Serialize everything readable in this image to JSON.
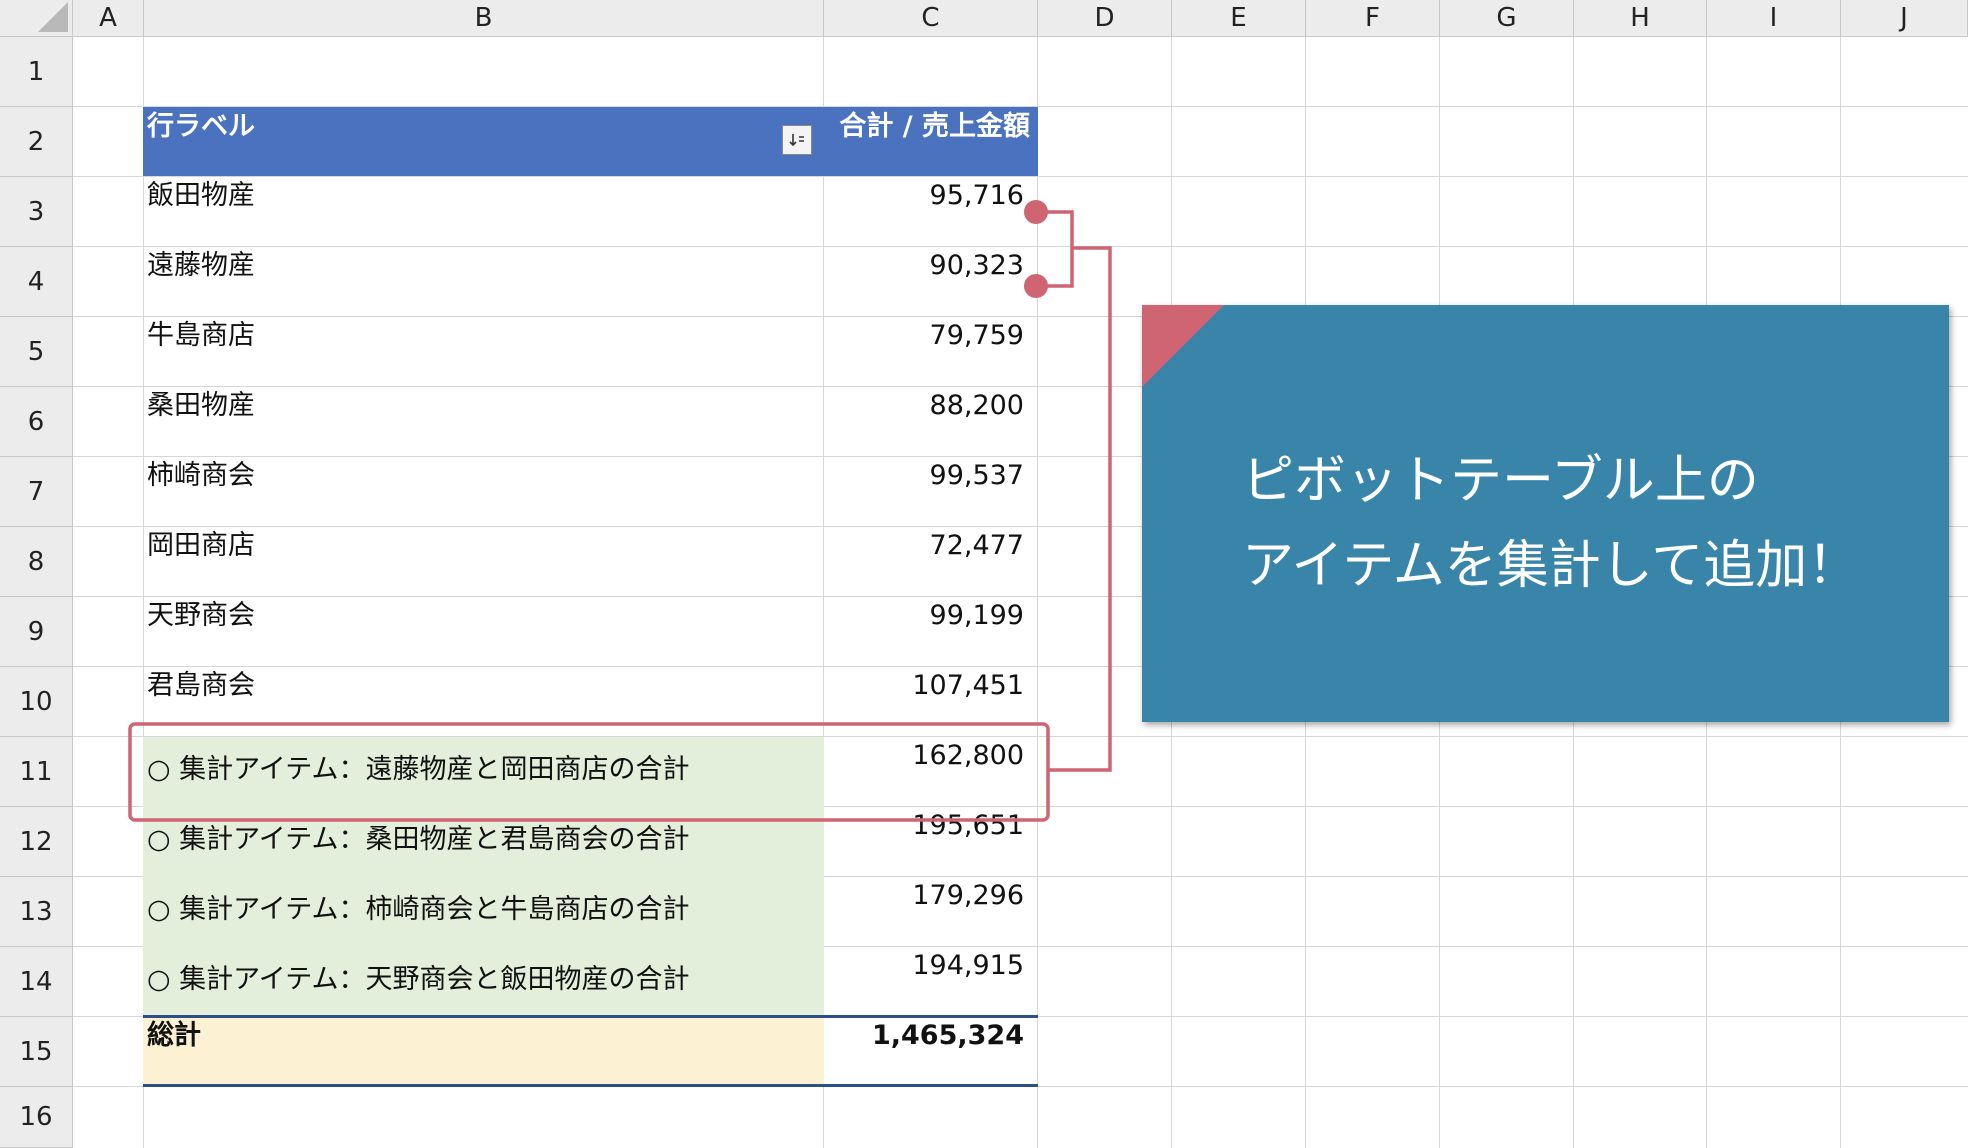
{
  "columns": [
    "A",
    "B",
    "C",
    "D",
    "E",
    "F",
    "G",
    "H",
    "I",
    "J"
  ],
  "rows": [
    "1",
    "2",
    "3",
    "4",
    "5",
    "6",
    "7",
    "8",
    "9",
    "10",
    "11",
    "12",
    "13",
    "14",
    "15",
    "16"
  ],
  "pivot": {
    "header_label": "行ラベル",
    "header_value": "合計 / 売上金額",
    "filter_icon": "filter-sort-icon",
    "items": [
      {
        "label": "飯田物産",
        "value": "95,716"
      },
      {
        "label": "遠藤物産",
        "value": "90,323"
      },
      {
        "label": "牛島商店",
        "value": "79,759"
      },
      {
        "label": "桑田物産",
        "value": "88,200"
      },
      {
        "label": "柿崎商会",
        "value": "99,537"
      },
      {
        "label": "岡田商店",
        "value": "72,477"
      },
      {
        "label": "天野商会",
        "value": "99,199"
      },
      {
        "label": "君島商会",
        "value": "107,451"
      }
    ],
    "calc_items": [
      {
        "label": "○ 集計アイテム：遠藤物産と岡田商店の合計",
        "value": "162,800"
      },
      {
        "label": "○ 集計アイテム：桑田物産と君島商会の合計",
        "value": "195,651"
      },
      {
        "label": "○ 集計アイテム：柿崎商会と牛島商店の合計",
        "value": "179,296"
      },
      {
        "label": "○ 集計アイテム：天野商会と飯田物産の合計",
        "value": "194,915"
      }
    ],
    "total_label": "総計",
    "total_value": "1,465,324"
  },
  "callout": {
    "line1": "ピボットテーブル上の",
    "line2": "アイテムを集計して追加！"
  },
  "colors": {
    "header_blue": "#4a72be",
    "calc_green": "#e3eedb",
    "total_yellow": "#fcf2d3",
    "callout_blue": "#3885a9",
    "highlight_red": "#cf6472"
  }
}
